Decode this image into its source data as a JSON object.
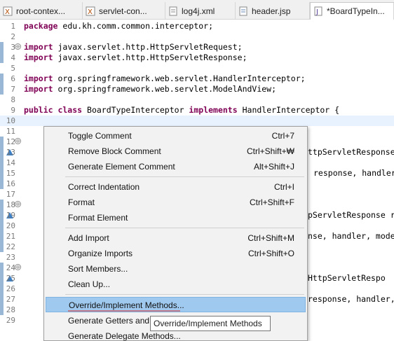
{
  "tabs": [
    {
      "label": "root-contex...",
      "icon": "xml-file-icon",
      "active": false
    },
    {
      "label": "servlet-con...",
      "icon": "xml-file-icon",
      "active": false
    },
    {
      "label": "log4j.xml",
      "icon": "xml-file-icon",
      "active": false
    },
    {
      "label": "header.jsp",
      "icon": "jsp-file-icon",
      "active": false
    },
    {
      "label": "*BoardTypeIn...",
      "icon": "java-file-icon",
      "active": true
    }
  ],
  "editor": {
    "lines": [
      {
        "n": "1",
        "fold": "",
        "kw": "package",
        "rest": " edu.kh.comm.common.interceptor;"
      },
      {
        "n": "2",
        "fold": "",
        "kw": "",
        "rest": ""
      },
      {
        "n": "3",
        "fold": "⊖",
        "kw": "import",
        "rest": " javax.servlet.http.HttpServletRequest;"
      },
      {
        "n": "4",
        "fold": "",
        "kw": "import",
        "rest": " javax.servlet.http.HttpServletResponse;"
      },
      {
        "n": "5",
        "fold": "",
        "kw": "",
        "rest": ""
      },
      {
        "n": "6",
        "fold": "",
        "kw": "import",
        "rest": " org.springframework.web.servlet.HandlerInterceptor;"
      },
      {
        "n": "7",
        "fold": "",
        "kw": "import",
        "rest": " org.springframework.web.servlet.ModelAndView;"
      },
      {
        "n": "8",
        "fold": "",
        "kw": "",
        "rest": ""
      },
      {
        "n": "9",
        "fold": "",
        "kw": "public class",
        "rest": " BoardTypeInterceptor implements HandlerInterceptor {"
      },
      {
        "n": "10",
        "fold": "",
        "kw": "",
        "rest": ""
      },
      {
        "n": "11",
        "fold": "",
        "kw": "",
        "rest": ""
      },
      {
        "n": "12",
        "fold": "⊖",
        "kw": "",
        "rest": ""
      },
      {
        "n": "13",
        "fold": "",
        "kw": "",
        "rest": ""
      },
      {
        "n": "14",
        "fold": "",
        "kw": "",
        "rest": ""
      },
      {
        "n": "15",
        "fold": "",
        "kw": "",
        "rest": ""
      },
      {
        "n": "16",
        "fold": "",
        "kw": "",
        "rest": ""
      },
      {
        "n": "17",
        "fold": "",
        "kw": "",
        "rest": ""
      },
      {
        "n": "18",
        "fold": "⊖",
        "kw": "",
        "rest": ""
      },
      {
        "n": "19",
        "fold": "",
        "kw": "",
        "rest": ""
      },
      {
        "n": "20",
        "fold": "",
        "kw": "",
        "rest": ""
      },
      {
        "n": "21",
        "fold": "",
        "kw": "",
        "rest": ""
      },
      {
        "n": "22",
        "fold": "",
        "kw": "",
        "rest": ""
      },
      {
        "n": "23",
        "fold": "",
        "kw": "",
        "rest": ""
      },
      {
        "n": "24",
        "fold": "⊖",
        "kw": "",
        "rest": ""
      },
      {
        "n": "25",
        "fold": "",
        "kw": "",
        "rest": ""
      },
      {
        "n": "26",
        "fold": "",
        "kw": "",
        "rest": ""
      },
      {
        "n": "27",
        "fold": "",
        "kw": "",
        "rest": ""
      },
      {
        "n": "28",
        "fold": "",
        "kw": "",
        "rest": ""
      },
      {
        "n": "29",
        "fold": "",
        "kw": "",
        "rest": ""
      }
    ],
    "implements_kw": "implements",
    "visible_right_fragments": [
      "ttpServletResponse",
      "response, handler",
      "pServletResponse r",
      "nse, handler, mode",
      "HttpServletRespo",
      "response, handler,"
    ]
  },
  "context_menu": {
    "items": [
      {
        "label": "Toggle Comment",
        "shortcut": "Ctrl+7"
      },
      {
        "label": "Remove Block Comment",
        "shortcut": "Ctrl+Shift+₩"
      },
      {
        "label": "Generate Element Comment",
        "shortcut": "Alt+Shift+J"
      },
      {
        "label": "Correct Indentation",
        "shortcut": "Ctrl+I"
      },
      {
        "label": "Format",
        "shortcut": "Ctrl+Shift+F"
      },
      {
        "label": "Format Element",
        "shortcut": ""
      },
      {
        "label": "Add Import",
        "shortcut": "Ctrl+Shift+M"
      },
      {
        "label": "Organize Imports",
        "shortcut": "Ctrl+Shift+O"
      },
      {
        "label": "Sort Members...",
        "shortcut": ""
      },
      {
        "label": "Clean Up...",
        "shortcut": ""
      },
      {
        "label": "Override/Implement Methods...",
        "shortcut": "",
        "highlighted": true
      },
      {
        "label": "Generate Getters and",
        "shortcut": ""
      },
      {
        "label": "Generate Delegate Methods...",
        "shortcut": ""
      }
    ],
    "tooltip": "Override/Implement Methods"
  },
  "colors": {
    "keyword": "#7f0055",
    "current_line": "#e8f2fe",
    "menu_highlight": "#9fc9ef"
  }
}
